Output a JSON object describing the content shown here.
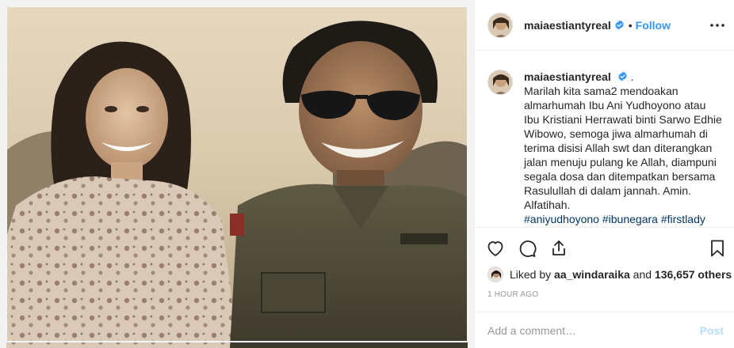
{
  "post": {
    "photo_alt": "Vintage photograph of a smiling woman in a floral dress and a smiling man in sunglasses and a military field jacket"
  },
  "header": {
    "username": "maiaestiantyreal",
    "verified_icon": "verified-badge-icon",
    "separator": "•",
    "follow_label": "Follow",
    "more_icon": "more-options-icon"
  },
  "caption": {
    "username": "maiaestiantyreal",
    "suffix": ".",
    "text": "Marilah kita sama2 mendoakan almarhumah Ibu Ani Yudhoyono atau Ibu Kristiani Herrawati binti Sarwo Edhie Wibowo, semoga jiwa almarhumah di terima disisi Allah swt dan diterangkan jalan menuju pulang ke Allah, diampuni segala dosa dan ditempatkan bersama Rasulullah di dalam jannah. Amin. Alfatihah.",
    "hashtags": [
      "#aniyudhoyono",
      "#ibunegara",
      "#firstlady"
    ]
  },
  "actions": {
    "like_icon": "heart-icon",
    "comment_icon": "comment-icon",
    "share_icon": "share-icon",
    "save_icon": "bookmark-icon"
  },
  "likes": {
    "prefix": "Liked by",
    "liker": "aa_windaraika",
    "conjunction": "and",
    "others": "136,657 others"
  },
  "timestamp": "1 HOUR AGO",
  "comment": {
    "placeholder": "Add a comment…",
    "post_label": "Post"
  },
  "colors": {
    "link_blue": "#3897f0",
    "hashtag": "#003569",
    "muted": "#999999",
    "border": "#efefef",
    "post_disabled": "#b2dffc"
  }
}
